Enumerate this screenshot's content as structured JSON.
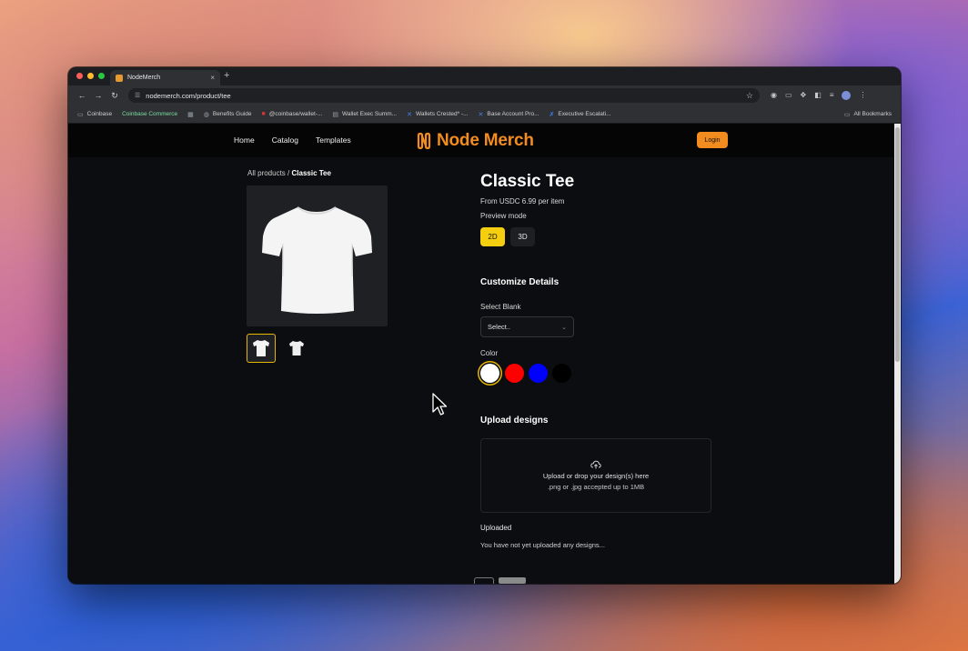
{
  "browser": {
    "tab_title": "NodeMerch",
    "tab_close": "×",
    "new_tab": "+",
    "url": "nodemerch.com/product/tee",
    "bookmarks": [
      {
        "label": "Coinbase",
        "icon": "folder-icon"
      },
      {
        "label": "Coinbase Commerce",
        "icon": "none"
      },
      {
        "label": "Benefits Guide",
        "icon": "globe-icon"
      },
      {
        "label": "@coinbase/wallet-...",
        "icon": "npm-icon"
      },
      {
        "label": "Wallet Exec Summ...",
        "icon": "doc-icon"
      },
      {
        "label": "Wallets Crested* -...",
        "icon": "confluence-icon"
      },
      {
        "label": "Base Account Pro...",
        "icon": "confluence-icon"
      },
      {
        "label": "Executive Escalati...",
        "icon": "jira-icon"
      }
    ],
    "all_bookmarks": "All Bookmarks"
  },
  "site": {
    "nav": [
      "Home",
      "Catalog",
      "Templates"
    ],
    "logo_text": "Node Merch",
    "login_label": "Login"
  },
  "product": {
    "breadcrumb_parent": "All products",
    "breadcrumb_sep": "/",
    "breadcrumb_current": "Classic Tee",
    "title": "Classic Tee",
    "price": "From USDC 6.99 per item",
    "preview_label": "Preview mode",
    "mode_2d": "2D",
    "mode_3d": "3D",
    "customize_heading": "Customize Details",
    "select_blank_label": "Select Blank",
    "select_placeholder": "Select..",
    "color_label": "Color",
    "colors": [
      "#ffffff",
      "#ff0000",
      "#0000ff",
      "#000000"
    ],
    "selected_color": "#ffffff",
    "upload_heading": "Upload designs",
    "upload_line1": "Upload or drop your design(s) here",
    "upload_line2": ".png or .jpg accepted up to 1MB",
    "uploaded_label": "Uploaded",
    "uploaded_empty": "You have not yet uploaded any designs..."
  },
  "theme": {
    "accent_orange": "#f28c1e",
    "accent_yellow": "#f5cf0f",
    "page_bg": "#0c0d10"
  }
}
